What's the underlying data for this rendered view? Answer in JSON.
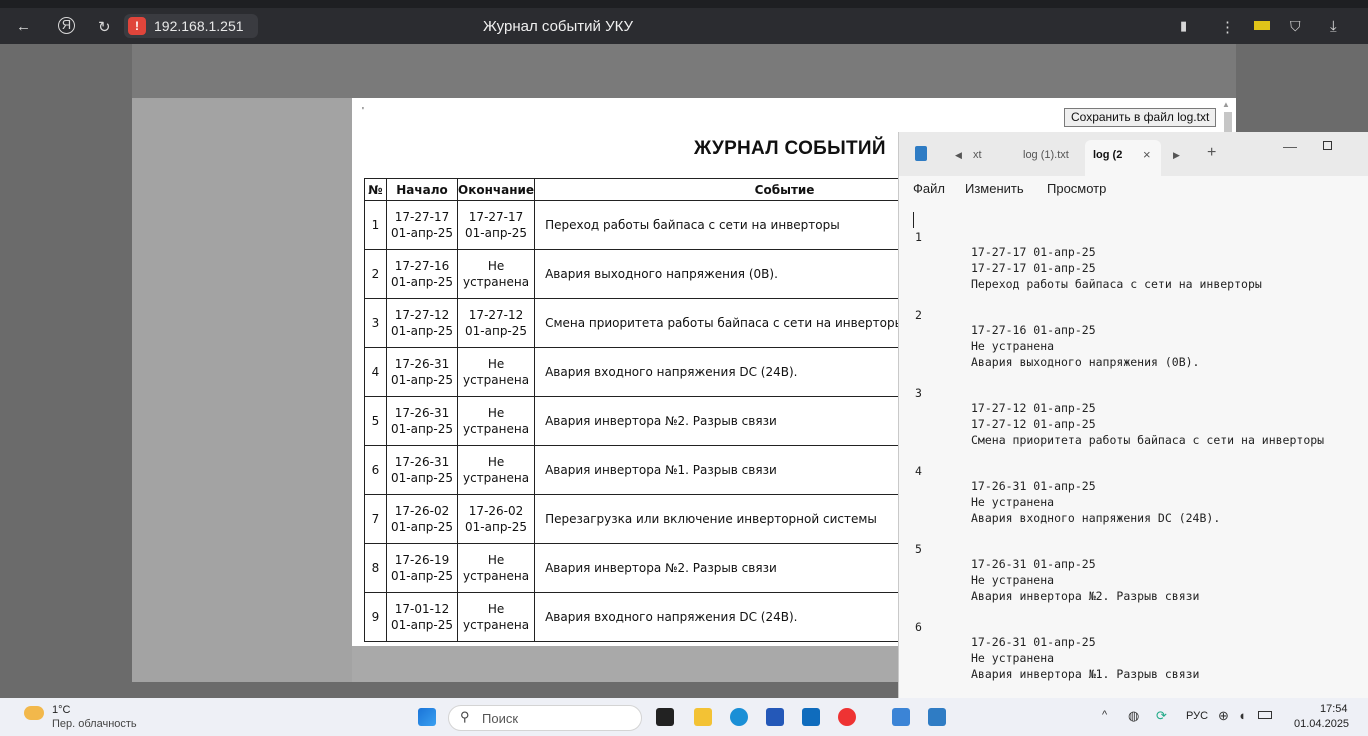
{
  "browser": {
    "address": "192.168.1.251",
    "page_title": "Журнал событий УКУ",
    "icons": [
      "back-icon",
      "yandex-icon",
      "reload-icon",
      "warning-icon",
      "bookmark-icon",
      "menu-icon",
      "battery-icon",
      "protect-icon",
      "download-icon"
    ]
  },
  "document": {
    "save_button": "Сохранить в файл log.txt",
    "heading": "ЖУРНАЛ СОБЫТИЙ",
    "dot": "'",
    "columns": [
      "№",
      "Начало",
      "Окончание",
      "Событие"
    ],
    "rows": [
      {
        "n": "1",
        "start_time": "17-27-17",
        "start_date": "01-апр-25",
        "end_time": "17-27-17",
        "end_date": "01-апр-25",
        "event": "Переход работы байпаса с сети на инверторы"
      },
      {
        "n": "2",
        "start_time": "17-27-16",
        "start_date": "01-апр-25",
        "end_time": "Не",
        "end_date": "устранена",
        "event": "Авария выходного напряжения (0В)."
      },
      {
        "n": "3",
        "start_time": "17-27-12",
        "start_date": "01-апр-25",
        "end_time": "17-27-12",
        "end_date": "01-апр-25",
        "event": "Смена приоритета работы байпаса с сети на инверторы"
      },
      {
        "n": "4",
        "start_time": "17-26-31",
        "start_date": "01-апр-25",
        "end_time": "Не",
        "end_date": "устранена",
        "event": "Авария входного напряжения DC (24В)."
      },
      {
        "n": "5",
        "start_time": "17-26-31",
        "start_date": "01-апр-25",
        "end_time": "Не",
        "end_date": "устранена",
        "event": "Авария инвертора №2. Разрыв связи"
      },
      {
        "n": "6",
        "start_time": "17-26-31",
        "start_date": "01-апр-25",
        "end_time": "Не",
        "end_date": "устранена",
        "event": "Авария инвертора №1. Разрыв связи"
      },
      {
        "n": "7",
        "start_time": "17-26-02",
        "start_date": "01-апр-25",
        "end_time": "17-26-02",
        "end_date": "01-апр-25",
        "event": "Перезагрузка или включение инверторной системы"
      },
      {
        "n": "8",
        "start_time": "17-26-19",
        "start_date": "01-апр-25",
        "end_time": "Не",
        "end_date": "устранена",
        "event": "Авария инвертора №2. Разрыв связи"
      },
      {
        "n": "9",
        "start_time": "17-01-12",
        "start_date": "01-апр-25",
        "end_time": "Не",
        "end_date": "устранена",
        "event": "Авария входного напряжения DC (24В)."
      }
    ]
  },
  "notepad": {
    "tabs": [
      "xt",
      "log (1).txt",
      "log (2"
    ],
    "menu": [
      "Файл",
      "Изменить",
      "Просмотр"
    ],
    "entries": [
      {
        "n": "1",
        "l1": "17-27-17 01-апр-25",
        "l2": "17-27-17 01-апр-25",
        "l3": "Переход работы байпаса с сети на инверторы"
      },
      {
        "n": "2",
        "l1": "17-27-16 01-апр-25",
        "l2": "Не устранена",
        "l3": "Авария выходного напряжения (0В)."
      },
      {
        "n": "3",
        "l1": "17-27-12 01-апр-25",
        "l2": "17-27-12 01-апр-25",
        "l3": "Смена приоритета работы байпаса с сети на инверторы"
      },
      {
        "n": "4",
        "l1": "17-26-31 01-апр-25",
        "l2": "Не устранена",
        "l3": "Авария входного напряжения DC (24В)."
      },
      {
        "n": "5",
        "l1": "17-26-31 01-апр-25",
        "l2": "Не устранена",
        "l3": "Авария инвертора №2. Разрыв связи"
      },
      {
        "n": "6",
        "l1": "17-26-31 01-апр-25",
        "l2": "Не устранена",
        "l3": "Авария инвертора №1. Разрыв связи"
      }
    ]
  },
  "taskbar": {
    "weather_temp": "1°C",
    "weather_desc": "Пер. облачность",
    "search_placeholder": "Поиск",
    "lang": "РУС",
    "time": "17:54",
    "date": "01.04.2025"
  }
}
